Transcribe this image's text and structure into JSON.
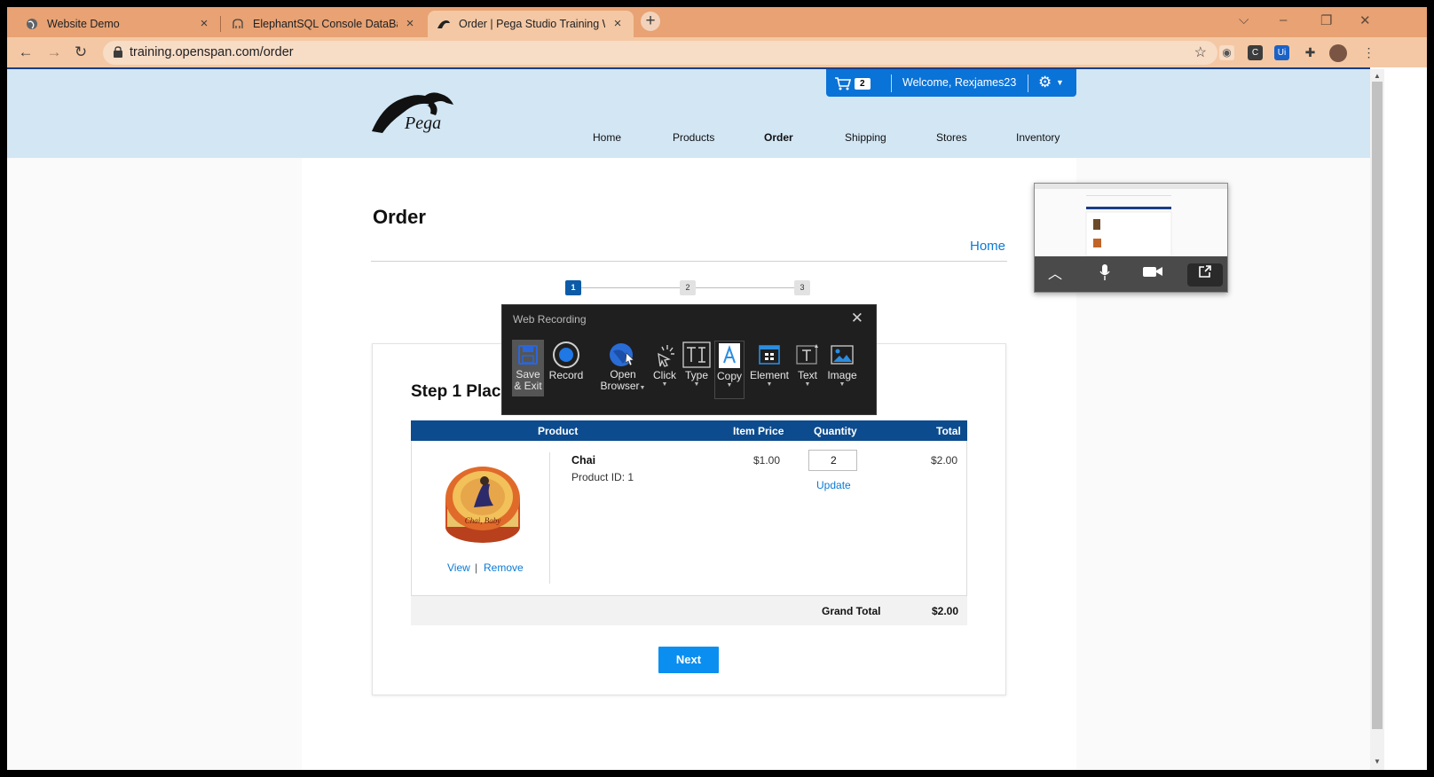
{
  "browser": {
    "tabs": [
      {
        "title": "Website Demo",
        "icon": "globe-icon",
        "active": false
      },
      {
        "title": "ElephantSQL Console DataBase f",
        "icon": "elephant-icon",
        "active": false
      },
      {
        "title": "Order | Pega Studio Training Web",
        "icon": "pega-icon",
        "active": true
      }
    ],
    "url": "training.openspan.com/order"
  },
  "site": {
    "logo_text": "Pega",
    "cart_count": "2",
    "welcome": "Welcome, Rexjames23",
    "nav": [
      "Home",
      "Products",
      "Order",
      "Shipping",
      "Stores",
      "Inventory"
    ],
    "current_nav": "Order"
  },
  "page": {
    "title": "Order",
    "home_link": "Home",
    "steps": [
      "1",
      "2",
      "3"
    ],
    "current_step": "1",
    "step_title": "Step 1 Plac",
    "table": {
      "headers": [
        "Product",
        "Item Price",
        "Quantity",
        "Total"
      ],
      "row": {
        "name": "Chai",
        "product_id": "Product ID: 1",
        "price": "$1.00",
        "quantity": "2",
        "total": "$2.00",
        "update": "Update",
        "view": "View",
        "separator": "|",
        "remove": "Remove"
      },
      "grand_total_label": "Grand Total",
      "grand_total": "$2.00"
    },
    "next": "Next"
  },
  "recorder": {
    "title": "Web Recording",
    "tools": [
      {
        "label1": "Save",
        "label2": "& Exit",
        "icon": "save-icon"
      },
      {
        "label1": "Record",
        "label2": "",
        "icon": "record-icon"
      },
      {
        "label1": "Open",
        "label2": "Browser",
        "icon": "globe-cursor-icon"
      },
      {
        "label1": "Click",
        "label2": "",
        "icon": "click-icon"
      },
      {
        "label1": "Type",
        "label2": "",
        "icon": "type-icon"
      },
      {
        "label1": "Copy",
        "label2": "",
        "icon": "copy-icon"
      },
      {
        "label1": "Element",
        "label2": "",
        "icon": "element-icon"
      },
      {
        "label1": "Text",
        "label2": "",
        "icon": "text-icon"
      },
      {
        "label1": "Image",
        "label2": "",
        "icon": "image-icon"
      }
    ]
  },
  "colors": {
    "tabbar": "#e8a273",
    "header_bg": "#d2e6f4",
    "primary_blue": "#0a73d8",
    "table_header": "#0c4b8e",
    "next_button": "#0a8ff0",
    "recorder_bg": "#1f1f1f"
  }
}
